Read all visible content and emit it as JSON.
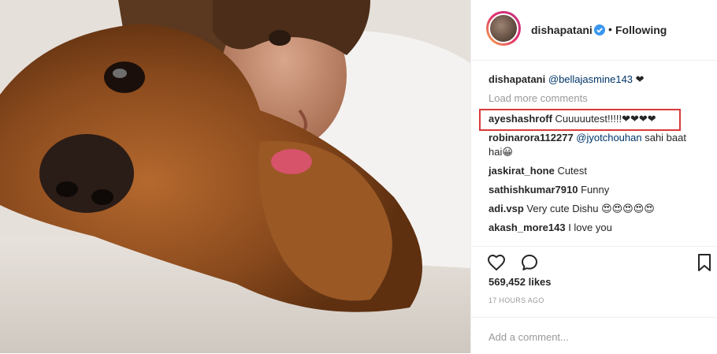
{
  "post": {
    "author": {
      "username": "dishapatani",
      "verified_icon": "verified-badge-icon",
      "follow_status": "Following",
      "separator": "•"
    },
    "image_alt": "selfie with dog"
  },
  "comments": {
    "caption": {
      "user": "dishapatani",
      "mention": "@bellajasmine143",
      "text": " ❤"
    },
    "load_more": "Load more comments",
    "items": [
      {
        "user": "ayeshashroff",
        "mention": "",
        "text": " Cuuuuutest!!!!!❤❤❤❤"
      },
      {
        "user": "robinarora112277",
        "mention": " @jyotchouhan",
        "text": " sahi baat",
        "text2": "hai😀"
      },
      {
        "user": "jaskirat_hone",
        "mention": "",
        "text": " Cutest"
      },
      {
        "user": "sathishkumar7910",
        "mention": "",
        "text": " Funny"
      },
      {
        "user": "adi.vsp",
        "mention": "",
        "text": " Very cute Dishu 😍😍😍😍😍"
      },
      {
        "user": "akash_more143",
        "mention": "",
        "text": " I love you"
      }
    ]
  },
  "actions": {
    "like_icon": "heart-icon",
    "comment_icon": "comment-icon",
    "save_icon": "bookmark-icon"
  },
  "stats": {
    "likes": "569,452 likes",
    "time": "17 HOURS AGO"
  },
  "composer": {
    "placeholder": "Add a comment..."
  },
  "colors": {
    "highlight": "#d93a3a",
    "verified": "#3897f0",
    "mention": "#003569",
    "muted": "#999999"
  }
}
